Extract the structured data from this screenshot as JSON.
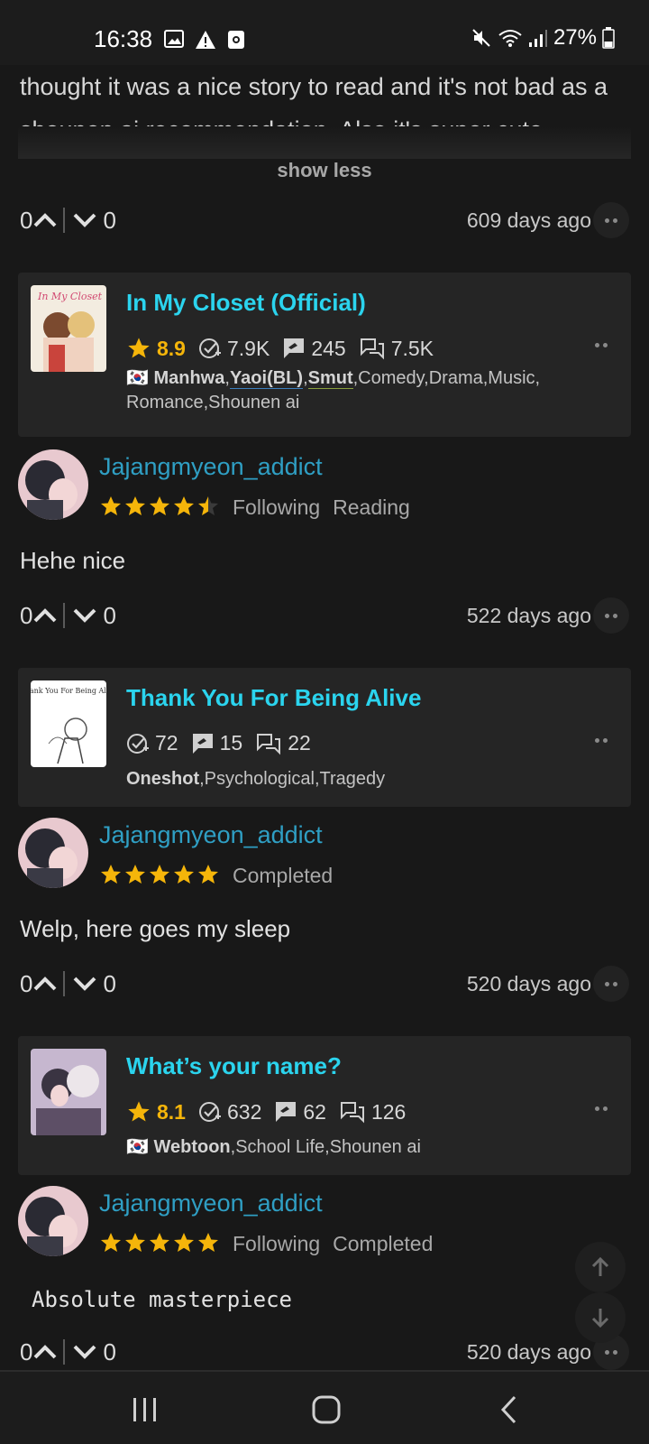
{
  "status_bar": {
    "time": "16:38",
    "battery": "27%",
    "left_icons": [
      "image-icon",
      "warning-icon",
      "screen-record-icon"
    ],
    "right_icons": [
      "mute-icon",
      "wifi-icon",
      "signal-icon",
      "battery-icon"
    ]
  },
  "previous_review": {
    "text": "thought it was a nice story to read and it's not bad as a shounen ai recommendation. Also it's super cute.",
    "show_less": "show less",
    "upvotes": "0",
    "downvotes": "0",
    "time": "609 days ago"
  },
  "entries": [
    {
      "title": "In My Closet (Official)",
      "rating": "8.9",
      "follows": "7.9K",
      "reviews": "245",
      "comments": "7.5K",
      "flag": "🇰🇷",
      "type": "Manhwa",
      "tag_ul1": "Yaoi(BL)",
      "tag_ul2": "Smut",
      "tags_rest": ",Comedy,Drama,Music, Romance,Shounen ai",
      "user": "Jajangmyeon_addict",
      "user_rating": 4.5,
      "status1": "Following",
      "status2": "Reading",
      "comment": "Hehe nice",
      "upvotes": "0",
      "downvotes": "0",
      "time": "522 days ago"
    },
    {
      "title": "Thank You For Being Alive",
      "follows": "72",
      "reviews": "15",
      "comments": "22",
      "type": "Oneshot",
      "tags_rest": ",Psychological,Tragedy",
      "cover_text": "Thank You For Being Alive",
      "user": "Jajangmyeon_addict",
      "user_rating": 5,
      "status1": "Completed",
      "comment": "Welp, here goes my sleep",
      "upvotes": "0",
      "downvotes": "0",
      "time": "520 days ago"
    },
    {
      "title": "What’s your name?",
      "rating": "8.1",
      "follows": "632",
      "reviews": "62",
      "comments": "126",
      "flag": "🇰🇷",
      "type": "Webtoon",
      "tags_rest": ",School Life,Shounen ai",
      "user": "Jajangmyeon_addict",
      "user_rating": 5,
      "status1": "Following",
      "status2": "Completed",
      "comment": "Absolute masterpiece",
      "upvotes": "0",
      "downvotes": "0",
      "time": "520 days ago"
    }
  ],
  "colors": {
    "title": "#2bd4ee",
    "username": "#2f9fc4",
    "star": "#f5b50a",
    "background": "#181818",
    "card": "#252525"
  },
  "navbar": [
    "recent-apps-icon",
    "home-icon",
    "back-icon"
  ]
}
